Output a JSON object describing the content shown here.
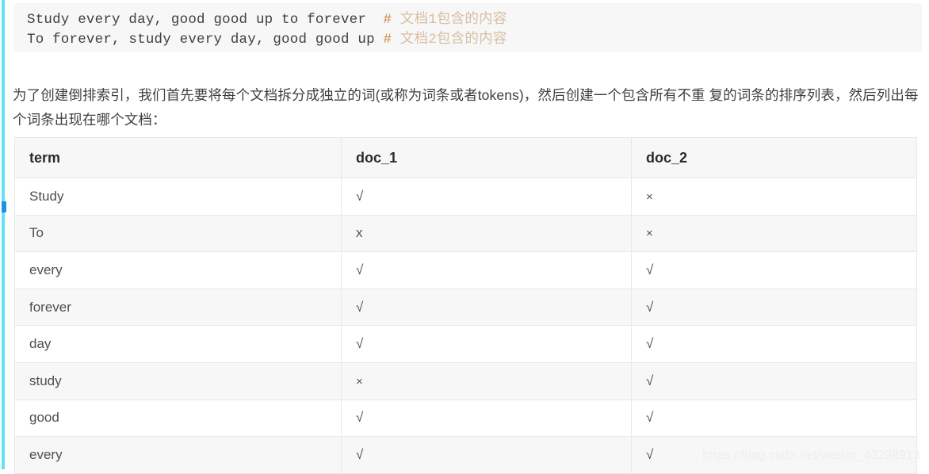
{
  "code_block": {
    "lines": [
      {
        "code": "Study every day, good good up to forever  ",
        "comment_hash": "# ",
        "comment_text": "文档1包含的内容"
      },
      {
        "code": "To forever, study every day, good good up ",
        "comment_hash": "# ",
        "comment_text": "文档2包含的内容"
      }
    ]
  },
  "paragraph": {
    "text": "为了创建倒排索引，我们首先要将每个文档拆分成独立的词(或称为词条或者tokens)，然后创建一个包含所有不重 复的词条的排序列表，然后列出每个词条出现在哪个文档："
  },
  "table": {
    "headers": [
      "term",
      "doc_1",
      "doc_2"
    ],
    "rows": [
      {
        "term": "Study",
        "doc_1": "√",
        "doc_2": "×"
      },
      {
        "term": "To",
        "doc_1": "x",
        "doc_2": "×"
      },
      {
        "term": "every",
        "doc_1": "√",
        "doc_2": "√"
      },
      {
        "term": "forever",
        "doc_1": "√",
        "doc_2": "√"
      },
      {
        "term": "day",
        "doc_1": "√",
        "doc_2": "√"
      },
      {
        "term": "study",
        "doc_1": "×",
        "doc_2": "√"
      },
      {
        "term": "good",
        "doc_1": "√",
        "doc_2": "√"
      },
      {
        "term": "every",
        "doc_1": "√",
        "doc_2": "√"
      }
    ]
  },
  "watermark": {
    "text": "https://blog.csdn.net/weixin_43298913"
  },
  "colors": {
    "code_block_bg": "#f7f7f8",
    "comment_hash": "#c8873e",
    "comment_cn": "#d8bfa0",
    "table_header_bg": "#f7f7f7",
    "table_stripe_bg": "#f7f7f7",
    "table_border": "#e8e8e8",
    "rail_cyan": "#66e0f5",
    "rail_thumb_blue": "#1a93e0",
    "watermark": "#ededed",
    "text": "#3f3f3f"
  }
}
